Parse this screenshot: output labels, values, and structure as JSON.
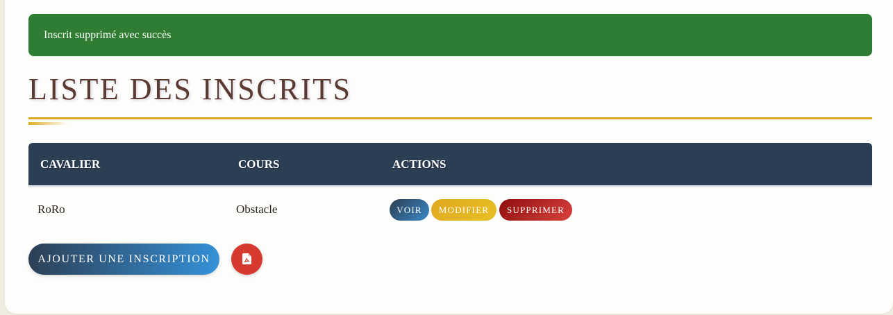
{
  "alert": {
    "message": "Inscrit supprimé avec succès",
    "color": "#2e7d32"
  },
  "page": {
    "title": "LISTE DES INSCRITS"
  },
  "table": {
    "columns": [
      "CAVALIER",
      "COURS",
      "ACTIONS"
    ],
    "rows": [
      {
        "cavalier": "RoRo",
        "cours": "Obstacle",
        "actions": {
          "view": "VOIR",
          "edit": "MODIFIER",
          "delete": "SUPPRIMER"
        }
      }
    ]
  },
  "footer": {
    "add_label": "AJOUTER UNE INSCRIPTION",
    "pdf_icon": "file-pdf-icon"
  },
  "colors": {
    "header_bg": "#2c3e53",
    "accent_gold": "#e0a820",
    "title": "#5b3a32",
    "danger": "#d63a2f"
  }
}
